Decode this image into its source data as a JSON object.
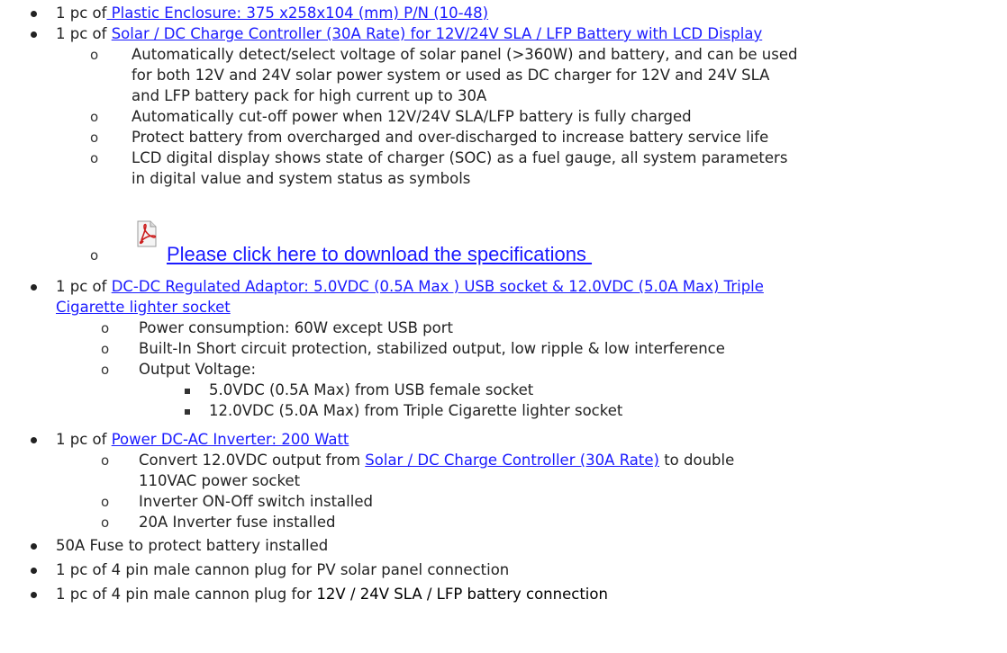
{
  "colors": {
    "link": "#1a1aff",
    "text": "#222222"
  },
  "items": {
    "enclosure": {
      "prefix": "1 pc of",
      "link": " Plastic Enclosure: 375 x258x104 (mm) P/N (10-48)"
    },
    "controller": {
      "prefix": "1 pc of ",
      "link": "Solar / DC Charge Controller (30A Rate) for 12V/24V SLA / LFP Battery with LCD Display",
      "sub": {
        "s1_l1": "Automatically detect/select voltage of solar panel (>360W) and battery, and can be used",
        "s1_l2": "for both 12V and 24V solar power system or used as DC charger for 12V and 24V  SLA",
        "s1_l3": "and LFP battery pack for high current up to 30A",
        "s2": "Automatically cut-off power when 12V/24V SLA/LFP battery is fully charged",
        "s3": "Protect battery from overcharged and over-discharged to increase battery service life",
        "s4_l1": "LCD digital display shows state of charger (SOC) as a fuel gauge, all system parameters",
        "s4_l2": "in digital value and system status as symbols",
        "download": "Please click here to download the specifications "
      }
    },
    "adaptor": {
      "prefix": "1 pc of ",
      "link_l1": "DC-DC Regulated Adaptor: 5.0VDC (0.5A Max ) USB socket & 12.0VDC (5.0A Max) Triple",
      "link_l2": "Cigarette lighter socket",
      "sub": {
        "s1": "Power consumption: 60W except USB port",
        "s2": "Built-In Short circuit protection, stabilized output, low ripple & low interference",
        "s3": "Output Voltage:",
        "v1": "5.0VDC (0.5A Max) from USB female socket",
        "v2": "12.0VDC (5.0A Max) from Triple Cigarette lighter socket"
      }
    },
    "inverter": {
      "prefix": "1 pc of ",
      "link": "Power DC-AC Inverter: 200 Watt",
      "sub": {
        "s1_pre": "Convert 12.0VDC output from ",
        "s1_link": "Solar / DC Charge Controller (30A Rate)",
        "s1_post": " to double",
        "s1_l2": "110VAC power socket",
        "s2": "Inverter ON-Off switch installed",
        "s3": "20A Inverter fuse installed"
      }
    },
    "fuse": "50A Fuse to protect battery installed",
    "pv_plug": "1 pc of 4 pin male cannon plug for PV solar panel connection",
    "batt_plug_pre": "1 pc of 4 pin male cannon plug for ",
    "batt_plug_dark": "12V / 24V SLA / LFP battery connection"
  },
  "icons": {
    "pdf": "pdf-icon",
    "bullet": "disc",
    "sub_bullet": "circle-o",
    "sub_sub_bullet": "square"
  }
}
